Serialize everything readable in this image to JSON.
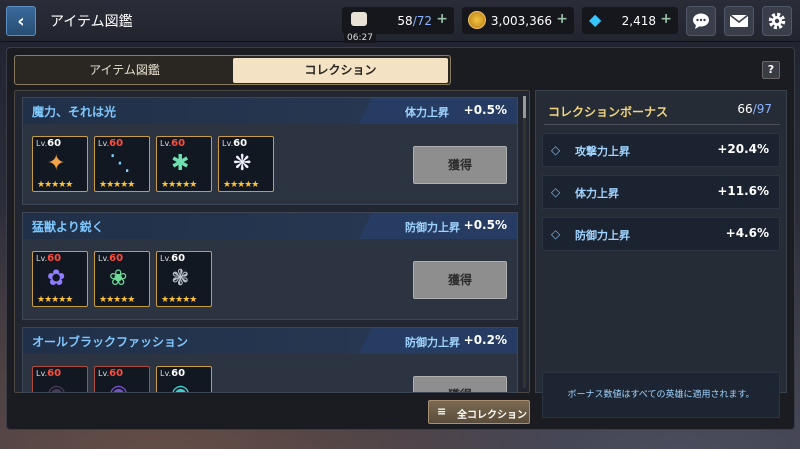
{
  "header": {
    "title": "アイテム図鑑",
    "stamina": {
      "current": "58",
      "max": "/72",
      "timer": "06:27"
    },
    "gold": "3,003,366",
    "gems": "2,418"
  },
  "tabs": {
    "catalog": "アイテム図鑑",
    "collection": "コレクション"
  },
  "help_label": "?",
  "collections": [
    {
      "title": "魔力、それは光",
      "bonus_label": "体力上昇",
      "bonus_value": "+0.5%",
      "button_label": "獲得",
      "items": [
        {
          "lv_prefix": "Lv.",
          "level": "60",
          "stars": "★★★★★",
          "level_red": false,
          "border_red": false,
          "icon": "staff-fire-icon"
        },
        {
          "lv_prefix": "Lv.",
          "level": "60",
          "stars": "★★★★★",
          "level_red": true,
          "border_red": false,
          "icon": "trident-ice-icon"
        },
        {
          "lv_prefix": "Lv.",
          "level": "60",
          "stars": "★★★★★",
          "level_red": true,
          "border_red": false,
          "icon": "staff-orb-icon"
        },
        {
          "lv_prefix": "Lv.",
          "level": "60",
          "stars": "★★★★★",
          "level_red": false,
          "border_red": false,
          "icon": "staff-light-icon"
        }
      ]
    },
    {
      "title": "猛獣より鋭く",
      "bonus_label": "防御力上昇",
      "bonus_value": "+0.5%",
      "button_label": "獲得",
      "items": [
        {
          "lv_prefix": "Lv.",
          "level": "60",
          "stars": "★★★★★",
          "level_red": true,
          "border_red": false,
          "icon": "claw-blue-icon"
        },
        {
          "lv_prefix": "Lv.",
          "level": "60",
          "stars": "★★★★★",
          "level_red": true,
          "border_red": false,
          "icon": "claw-green-icon"
        },
        {
          "lv_prefix": "Lv.",
          "level": "60",
          "stars": "★★★★★",
          "level_red": false,
          "border_red": false,
          "icon": "claw-dark-icon"
        }
      ]
    },
    {
      "title": "オールブラックファッション",
      "bonus_label": "防御力上昇",
      "bonus_value": "+0.2%",
      "button_label": "獲得",
      "items": [
        {
          "lv_prefix": "Lv.",
          "level": "60",
          "stars": "★★★★★",
          "level_red": true,
          "border_red": true,
          "icon": "armor-black-icon"
        },
        {
          "lv_prefix": "Lv.",
          "level": "60",
          "stars": "★★★★★",
          "level_red": true,
          "border_red": true,
          "icon": "helm-black-icon"
        },
        {
          "lv_prefix": "Lv.",
          "level": "60",
          "stars": "★★★★★",
          "level_red": false,
          "border_red": false,
          "icon": "boots-black-icon"
        }
      ]
    }
  ],
  "bonus_panel": {
    "title": "コレクションボーナス",
    "count": "66",
    "count_max": "/97",
    "rows": [
      {
        "name": "攻撃力上昇",
        "value": "+20.4%"
      },
      {
        "name": "体力上昇",
        "value": "+11.6%"
      },
      {
        "name": "防御力上昇",
        "value": "+4.6%"
      }
    ],
    "note": "ボーナス数値はすべての英雄に適用されます。"
  },
  "all_collections_label": "全コレクション",
  "colors": {
    "accent_blue": "#7ec7ff",
    "gold_border": "#c79c42",
    "red_level": "#ff4d3c"
  }
}
